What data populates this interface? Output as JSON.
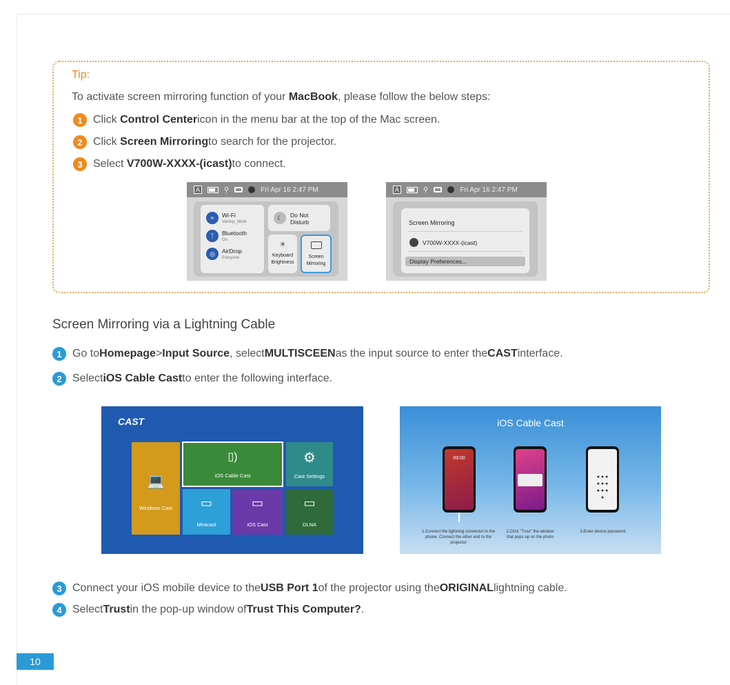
{
  "tip": {
    "title": "Tip:",
    "intro_pre": "To activate screen mirroring function of your ",
    "intro_bold": "MacBook",
    "intro_post": ", please follow the below steps:",
    "steps": [
      {
        "num": "1",
        "pre": "Click ",
        "bold": "Control Center",
        "post": " icon in the menu bar at the top of the Mac screen."
      },
      {
        "num": "2",
        "pre": "Click ",
        "bold": "Screen Mirroring",
        "post": " to search for the projector."
      },
      {
        "num": "3",
        "pre": "Select ",
        "bold": "V700W-XXXX-(icast)",
        "post": " to connect."
      }
    ]
  },
  "mac_shot_1": {
    "menubar_a": "A",
    "menubar_time": "Fri Apr 16 2:47 PM",
    "wifi": {
      "label": "Wi-Fi",
      "sub": "Vantop_Work"
    },
    "bluetooth": {
      "label": "Bluetooth",
      "sub": "On"
    },
    "airdrop": {
      "label": "AirDrop",
      "sub": "Everyone"
    },
    "dnd": "Do Not Disturb",
    "keyboard": "Keyboard Brightness",
    "mirroring": "Screen Mirroring"
  },
  "mac_shot_2": {
    "menubar_a": "A",
    "menubar_time": "Fri Apr 16 2:47 PM",
    "heading": "Screen Mirroring",
    "device": "V700W-XXXX-(icast)",
    "prefs": "Display Preferences..."
  },
  "section": {
    "title": "Screen Mirroring via a Lightning Cable",
    "steps": [
      {
        "num": "1",
        "parts": [
          "Go to ",
          "Homepage",
          " > ",
          "Input Source",
          ", select ",
          "MULTISCEEN",
          " as the input source to enter the ",
          "CAST",
          " interface."
        ]
      },
      {
        "num": "2",
        "parts": [
          "Select ",
          "iOS Cable Cast",
          " to enter the following interface."
        ]
      },
      {
        "num": "3",
        "parts": [
          "Connect your iOS mobile device to the ",
          "USB Port 1",
          " of the projector using the ",
          "ORIGINAL",
          " lightning cable."
        ]
      },
      {
        "num": "4",
        "parts": [
          "Select ",
          "Trust",
          " in the pop-up window of ",
          "Trust This Computer?",
          "."
        ]
      }
    ]
  },
  "cast_screen": {
    "logo": "CAST",
    "tiles": {
      "windows": "Windows Cast",
      "ios_cable": "iOS Cable Cast",
      "settings": "Cast Settings",
      "miracast": "Miracast",
      "ios_cast": "iOS Cast",
      "dlna": "DLNA"
    }
  },
  "ios_cable_screen": {
    "title": "iOS Cable Cast",
    "phone1_time": "09:00",
    "captions": [
      "1.Connect the lightning connector to the phone. Connect the other end to the projector",
      "2.Click \"Trust\" the window that pops up on the photo",
      "3.Enter device password."
    ]
  },
  "page_number": "10"
}
